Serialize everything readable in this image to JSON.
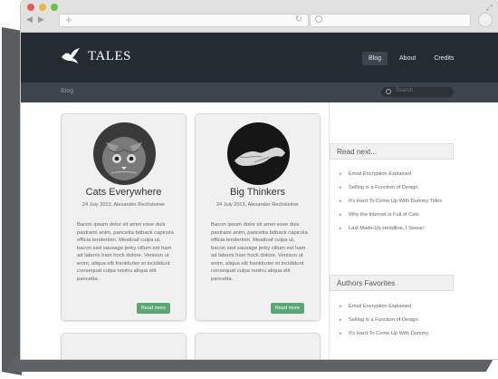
{
  "browser": {
    "search_placeholder": ""
  },
  "site": {
    "title": "TALES",
    "menu": [
      {
        "label": "Blog"
      },
      {
        "label": "About"
      },
      {
        "label": "Credits"
      }
    ],
    "breadcrumb": "Blog",
    "search_placeholder": "Search"
  },
  "posts": [
    {
      "title": "Cats Everywhere",
      "meta": "24 July 2013, Alexander Rechsteiner",
      "body": "Bacon ipsum dolor sit amet esse duis pastrami anim, pancetta fatback capicola officia tenderloin. Meatloaf culpa ut, bacon sed sausage jerky cillum est ham ad laboris ham hock dolore. Venison ut enim, aliqua elit frankfurter et incididunt consequat culpa nostru aliqua elit pancetta.",
      "button": "Read more"
    },
    {
      "title": "Big Thinkers",
      "meta": "24 July 2013, Alexander Rechsteiner",
      "body": "Bacon ipsum dolor sit amet esse duis pastrami anim, pancetta fatback capicola officia tenderloin. Meatloaf culpa ut, bacon sed sausage jerky cillum est ham ad laboris ham hock dolore. Venison ut enim, aliqua elit frankfurter et incididunt consequat culpa nostru aliqua elit pancetta.",
      "button": "Read more"
    }
  ],
  "sidebar": {
    "read_next": {
      "heading": "Read next...",
      "items": [
        {
          "label": "Email Encryption Explained"
        },
        {
          "label": "Selling is a Function of Design."
        },
        {
          "label": "It's Hard To Come Up With Dummy Titles"
        },
        {
          "label": "Why the Internet is Full of Cats"
        },
        {
          "label": "Last Made-Up Headline, I Swear!"
        }
      ]
    },
    "authors_favorites": {
      "heading": "Authors Favorites",
      "items": [
        {
          "label": "Email Encryption Explained"
        },
        {
          "label": "Selling is a Function of Design."
        },
        {
          "label": "It's Hard To Come Up With Dummy"
        }
      ]
    }
  },
  "colors": {
    "header_bg": "#252b32",
    "subbar_bg": "#3c444d",
    "accent_button": "#56a970"
  }
}
